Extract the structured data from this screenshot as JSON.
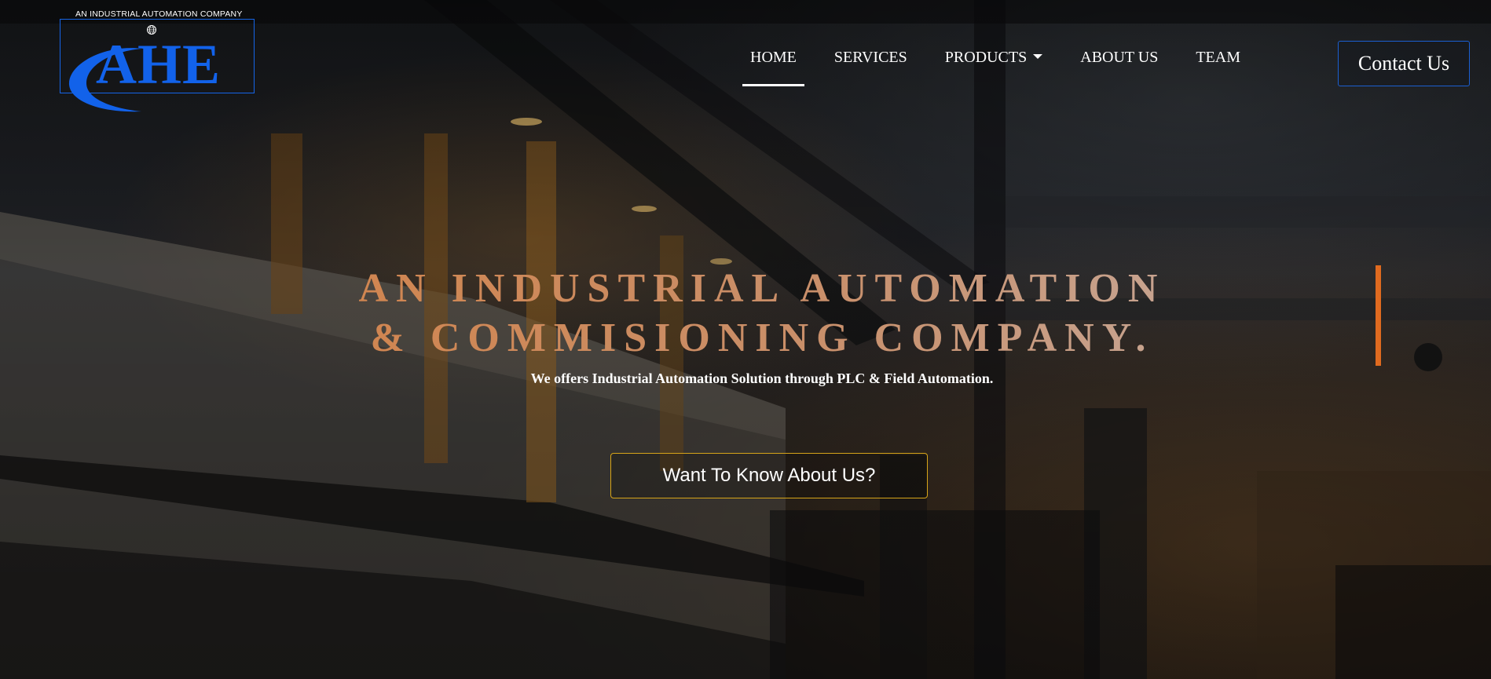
{
  "logo": {
    "tagline": "AN INDUSTRIAL AUTOMATION COMPANY",
    "wordmark": "AHE",
    "globe_icon": "globe-icon",
    "color": "#1262ea"
  },
  "nav": {
    "items": [
      {
        "label": "HOME",
        "active": true
      },
      {
        "label": "SERVICES",
        "active": false
      },
      {
        "label": "PRODUCTS",
        "active": false,
        "dropdown": true
      },
      {
        "label": "ABOUT US",
        "active": false
      },
      {
        "label": "TEAM",
        "active": false
      }
    ],
    "contact_label": "Contact Us"
  },
  "hero": {
    "headline_line1": "AN INDUSTRIAL AUTOMATION",
    "headline_line2": "& COMMISIONING COMPANY.",
    "subline": "We offers Industrial Automation Solution through PLC & Field Automation.",
    "cta_label": "Want To Know About Us?"
  },
  "colors": {
    "accent": "#e06a1f",
    "cta_border": "#d6a419",
    "contact_border": "#1b5fd1",
    "headline_gradient_start": "#d2834a",
    "headline_gradient_end": "#c6aa9c"
  }
}
